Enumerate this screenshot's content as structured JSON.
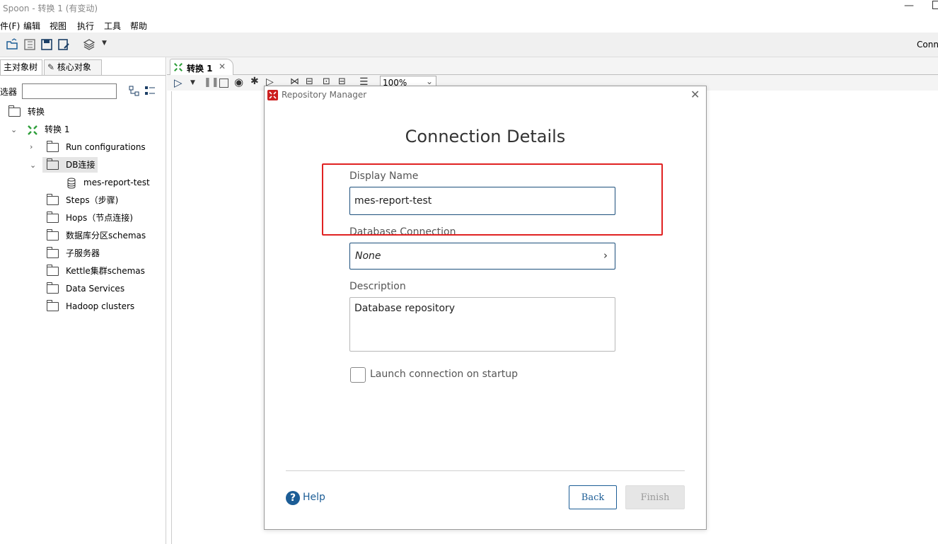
{
  "window": {
    "title": "Spoon - 转换 1 (有变动)"
  },
  "menu": [
    "件(F)",
    "编辑",
    "视图",
    "执行",
    "工具",
    "帮助"
  ],
  "toolbar": {
    "right_text": "Conn"
  },
  "left_panel": {
    "tabs": [
      "主对象树",
      "核心对象"
    ],
    "filter_label": "选器",
    "filter_value": "",
    "tree": {
      "root": "转换",
      "trans": "转换 1",
      "run_configs": "Run configurations",
      "db_conn": "DB连接",
      "db_item": "mes-report-test",
      "steps": "Steps（步骤)",
      "hops": "Hops（节点连接)",
      "schemas": "数据库分区schemas",
      "subservers": "子服务器",
      "kettle": "Kettle集群schemas",
      "data_services": "Data Services",
      "hadoop": "Hadoop clusters"
    }
  },
  "editor": {
    "tab_label": "转换 1",
    "zoom": "100%"
  },
  "dialog": {
    "title": "Repository Manager",
    "heading": "Connection Details",
    "display_name_label": "Display Name",
    "display_name_value": "mes-report-test",
    "db_conn_label": "Database Connection",
    "db_conn_value": "None",
    "description_label": "Description",
    "description_value": "Database repository",
    "startup_label": "Launch connection on startup",
    "startup_checked": false,
    "help_label": "Help",
    "back_label": "Back",
    "finish_label": "Finish"
  },
  "colors": {
    "accent": "#1c5d96",
    "highlight": "#e02222",
    "kettle_green": "#2e9e3a"
  }
}
